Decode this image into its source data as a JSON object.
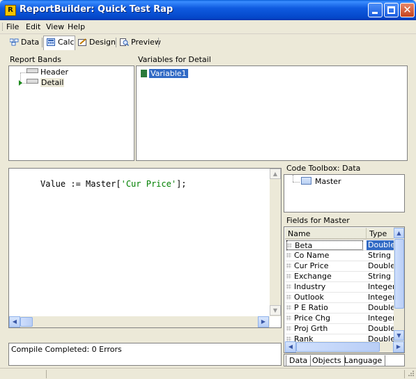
{
  "window": {
    "title": "ReportBuilder: Quick Test Rap",
    "app_icon_letter": "R"
  },
  "menu": [
    "File",
    "Edit",
    "View",
    "Help"
  ],
  "tabs": [
    {
      "label": "Data",
      "icon": "data-icon",
      "active": false
    },
    {
      "label": "Calc",
      "icon": "calc-icon",
      "active": true
    },
    {
      "label": "Design",
      "icon": "design-icon",
      "active": false
    },
    {
      "label": "Preview",
      "icon": "preview-icon",
      "active": false
    }
  ],
  "report_bands": {
    "heading": "Report Bands",
    "items": [
      "Header",
      "Detail"
    ],
    "selected": "Detail"
  },
  "variables": {
    "heading": "Variables for Detail",
    "items": [
      "Variable1"
    ]
  },
  "code": {
    "prefix": "Value := Master[",
    "string": "'Cur Price'",
    "suffix": "];"
  },
  "compile": {
    "status": "Compile Completed: 0 Errors"
  },
  "code_toolbox": {
    "heading": "Code Toolbox: Data",
    "node": "Master"
  },
  "fields": {
    "heading": "Fields for Master",
    "columns": [
      "Name",
      "Type"
    ],
    "rows": [
      {
        "name": "Beta",
        "type": "Double"
      },
      {
        "name": "Co Name",
        "type": "String"
      },
      {
        "name": "Cur Price",
        "type": "Double"
      },
      {
        "name": "Exchange",
        "type": "String"
      },
      {
        "name": "Industry",
        "type": "Integer"
      },
      {
        "name": "Outlook",
        "type": "Integer"
      },
      {
        "name": "P E Ratio",
        "type": "Double"
      },
      {
        "name": "Price Chg",
        "type": "Integer"
      },
      {
        "name": "Proj Grth",
        "type": "Double"
      },
      {
        "name": "Rank",
        "type": "Double"
      }
    ],
    "selected": "Beta"
  },
  "bottom_tabs": [
    "Data",
    "Objects",
    "Language"
  ],
  "colors": {
    "selection": "#316ac5",
    "string_literal": "#008000",
    "titlebar": "#0447c9",
    "panel": "#ece9d8"
  }
}
